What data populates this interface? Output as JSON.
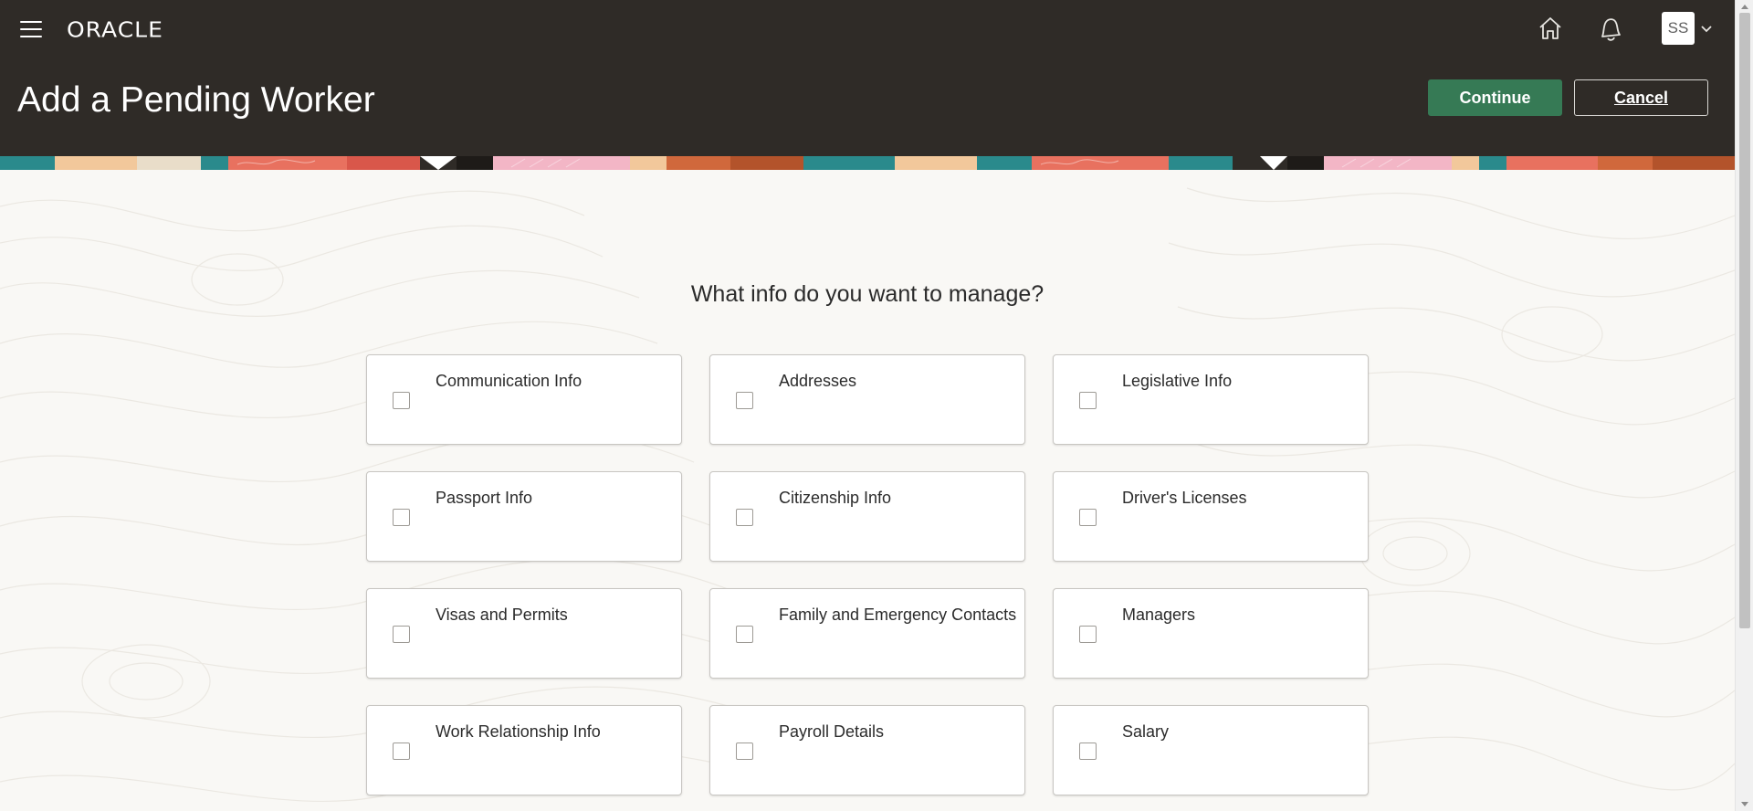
{
  "header": {
    "menu_icon": "hamburger-menu-icon",
    "logo": "ORACLE",
    "home_icon": "home-icon",
    "notifications_icon": "bell-icon",
    "user_initials": "SS",
    "user_menu_icon": "chevron-down-icon"
  },
  "page": {
    "title": "Add a Pending Worker",
    "continue_label": "Continue",
    "cancel_label": "Cancel"
  },
  "main": {
    "question": "What info do you want to manage?",
    "options": [
      {
        "label": "Communication Info",
        "checked": false
      },
      {
        "label": "Addresses",
        "checked": false
      },
      {
        "label": "Legislative Info",
        "checked": false
      },
      {
        "label": "Passport Info",
        "checked": false
      },
      {
        "label": "Citizenship Info",
        "checked": false
      },
      {
        "label": "Driver's Licenses",
        "checked": false
      },
      {
        "label": "Visas and Permits",
        "checked": false
      },
      {
        "label": "Family and Emergency Contacts",
        "checked": false
      },
      {
        "label": "Managers",
        "checked": false
      },
      {
        "label": "Work Relationship Info",
        "checked": false
      },
      {
        "label": "Payroll Details",
        "checked": false
      },
      {
        "label": "Salary",
        "checked": false
      }
    ]
  },
  "colors": {
    "header_bg": "#2f2b27",
    "primary_button": "#367a55",
    "page_bg": "#f9f8f5"
  }
}
